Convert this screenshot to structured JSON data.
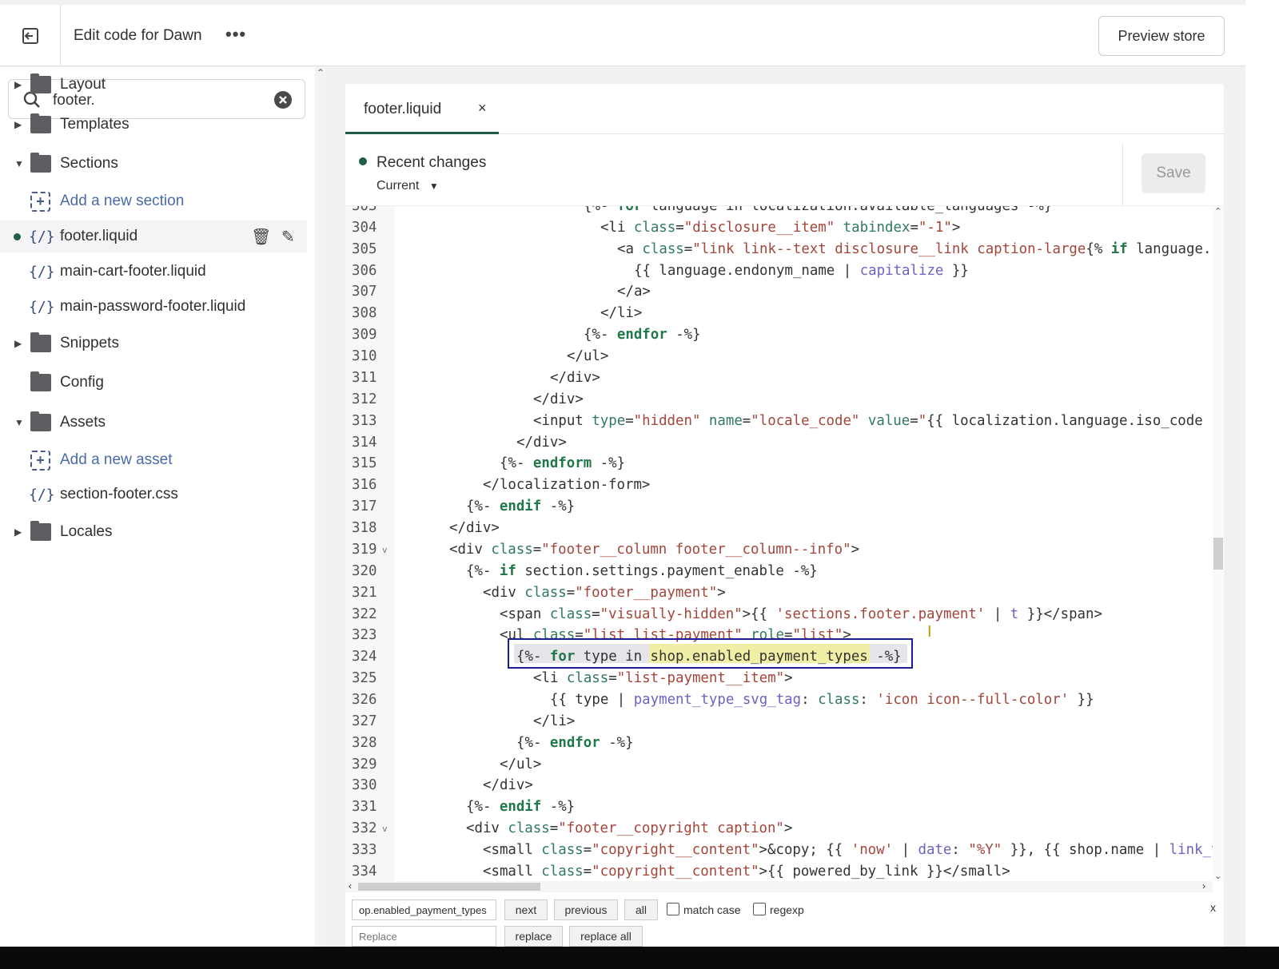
{
  "header": {
    "title": "Edit code for Dawn",
    "more_label": "•••",
    "preview_label": "Preview store",
    "back_icon": "exit-icon"
  },
  "sidebar": {
    "search_value": "footer.",
    "items": [
      {
        "type": "folder",
        "label": "Layout",
        "expanded": false
      },
      {
        "type": "folder",
        "label": "Templates",
        "expanded": false
      },
      {
        "type": "folder",
        "label": "Sections",
        "expanded": true
      },
      {
        "type": "add",
        "label": "Add a new section"
      },
      {
        "type": "file",
        "label": "footer.liquid",
        "active": true,
        "modified": true
      },
      {
        "type": "file",
        "label": "main-cart-footer.liquid"
      },
      {
        "type": "file",
        "label": "main-password-footer.liquid"
      },
      {
        "type": "folder",
        "label": "Snippets",
        "expanded": false
      },
      {
        "type": "folder",
        "label": "Config",
        "noarrow": true
      },
      {
        "type": "folder",
        "label": "Assets",
        "expanded": true
      },
      {
        "type": "add",
        "label": "Add a new asset"
      },
      {
        "type": "file",
        "label": "section-footer.css"
      },
      {
        "type": "folder",
        "label": "Locales",
        "expanded": false
      }
    ]
  },
  "editor": {
    "tab": {
      "label": "footer.liquid",
      "close": "×"
    },
    "recent_changes": "Recent changes",
    "version": "Current",
    "save_label": "Save",
    "lines": [
      {
        "n": "303",
        "i": 22,
        "tk": [
          [
            "p",
            "{%- "
          ],
          [
            "k",
            "for"
          ],
          [
            "p",
            " language in localization.available_languages -%}"
          ]
        ]
      },
      {
        "n": "304",
        "i": 24,
        "tk": [
          [
            "t",
            "<li "
          ],
          [
            "a",
            "class"
          ],
          [
            "t",
            "="
          ],
          [
            "s",
            "\"disclosure__item\""
          ],
          [
            "a",
            " tabindex"
          ],
          [
            "t",
            "="
          ],
          [
            "s",
            "\"-1\""
          ],
          [
            "t",
            ">"
          ]
        ]
      },
      {
        "n": "305",
        "i": 26,
        "tk": [
          [
            "t",
            "<a "
          ],
          [
            "a",
            "class"
          ],
          [
            "t",
            "="
          ],
          [
            "s",
            "\"link link--text disclosure__link caption-large"
          ],
          [
            "p",
            "{% "
          ],
          [
            "k",
            "if"
          ],
          [
            "p",
            " language.iso_code == localization.language.iso_code %}"
          ]
        ]
      },
      {
        "n": "306",
        "i": 28,
        "tk": [
          [
            "p",
            "{{ language.endonym_name | "
          ],
          [
            "f",
            "capitalize"
          ],
          [
            "p",
            " }}"
          ]
        ]
      },
      {
        "n": "307",
        "i": 26,
        "tk": [
          [
            "t",
            "</a>"
          ]
        ]
      },
      {
        "n": "308",
        "i": 24,
        "tk": [
          [
            "t",
            "</li>"
          ]
        ]
      },
      {
        "n": "309",
        "i": 22,
        "tk": [
          [
            "p",
            "{%- "
          ],
          [
            "k",
            "endfor"
          ],
          [
            "p",
            " -%}"
          ]
        ]
      },
      {
        "n": "310",
        "i": 20,
        "tk": [
          [
            "t",
            "</ul>"
          ]
        ]
      },
      {
        "n": "311",
        "i": 18,
        "tk": [
          [
            "t",
            "</div>"
          ]
        ]
      },
      {
        "n": "312",
        "i": 16,
        "tk": [
          [
            "t",
            "</div>"
          ]
        ]
      },
      {
        "n": "313",
        "i": 16,
        "tk": [
          [
            "t",
            "<input "
          ],
          [
            "a",
            "type"
          ],
          [
            "t",
            "="
          ],
          [
            "s",
            "\"hidden\""
          ],
          [
            "a",
            " name"
          ],
          [
            "t",
            "="
          ],
          [
            "s",
            "\"locale_code\""
          ],
          [
            "a",
            " value"
          ],
          [
            "t",
            "="
          ],
          [
            "s",
            "\""
          ],
          [
            "p",
            "{{ localization.language.iso_code }}"
          ],
          [
            "s",
            "\""
          ],
          [
            "t",
            ">"
          ]
        ]
      },
      {
        "n": "314",
        "i": 14,
        "tk": [
          [
            "t",
            "</div>"
          ]
        ]
      },
      {
        "n": "315",
        "i": 12,
        "tk": [
          [
            "p",
            "{%- "
          ],
          [
            "k",
            "endform"
          ],
          [
            "p",
            " -%}"
          ]
        ]
      },
      {
        "n": "316",
        "i": 10,
        "tk": [
          [
            "t",
            "</localization-form>"
          ]
        ]
      },
      {
        "n": "317",
        "i": 8,
        "tk": [
          [
            "p",
            "{%- "
          ],
          [
            "k",
            "endif"
          ],
          [
            "p",
            " -%}"
          ]
        ]
      },
      {
        "n": "318",
        "i": 6,
        "tk": [
          [
            "t",
            "</div>"
          ]
        ]
      },
      {
        "n": "319",
        "i": 6,
        "fold": true,
        "tk": [
          [
            "t",
            "<div "
          ],
          [
            "a",
            "class"
          ],
          [
            "t",
            "="
          ],
          [
            "s",
            "\"footer__column footer__column--info\""
          ],
          [
            "t",
            ">"
          ]
        ]
      },
      {
        "n": "320",
        "i": 8,
        "tk": [
          [
            "p",
            "{%- "
          ],
          [
            "k",
            "if"
          ],
          [
            "p",
            " section.settings.payment_enable -%}"
          ]
        ]
      },
      {
        "n": "321",
        "i": 10,
        "tk": [
          [
            "t",
            "<div "
          ],
          [
            "a",
            "class"
          ],
          [
            "t",
            "="
          ],
          [
            "s",
            "\"footer__payment\""
          ],
          [
            "t",
            ">"
          ]
        ]
      },
      {
        "n": "322",
        "i": 12,
        "tk": [
          [
            "t",
            "<span "
          ],
          [
            "a",
            "class"
          ],
          [
            "t",
            "="
          ],
          [
            "s",
            "\"visually-hidden\""
          ],
          [
            "t",
            ">"
          ],
          [
            "p",
            "{{ "
          ],
          [
            "s",
            "'sections.footer.payment'"
          ],
          [
            "p",
            " | "
          ],
          [
            "f",
            "t"
          ],
          [
            "p",
            " }}"
          ],
          [
            "t",
            "</span>"
          ]
        ]
      },
      {
        "n": "323",
        "i": 12,
        "tk": [
          [
            "t",
            "<ul "
          ],
          [
            "a",
            "class"
          ],
          [
            "t",
            "="
          ],
          [
            "s",
            "\"list list-payment\""
          ],
          [
            "a",
            " role"
          ],
          [
            "t",
            "="
          ],
          [
            "s",
            "\"list\""
          ],
          [
            "t",
            ">"
          ]
        ]
      },
      {
        "n": "324",
        "i": 14,
        "tk": [
          [
            "p",
            "{%- "
          ],
          [
            "k",
            "for"
          ],
          [
            "p",
            " type in shop.enabled_payment_types -%}"
          ]
        ]
      },
      {
        "n": "325",
        "i": 16,
        "tk": [
          [
            "t",
            "<li "
          ],
          [
            "a",
            "class"
          ],
          [
            "t",
            "="
          ],
          [
            "s",
            "\"list-payment__item\""
          ],
          [
            "t",
            ">"
          ]
        ]
      },
      {
        "n": "326",
        "i": 18,
        "tk": [
          [
            "p",
            "{{ type | "
          ],
          [
            "f",
            "payment_type_svg_tag"
          ],
          [
            "p",
            ": "
          ],
          [
            "a",
            "class"
          ],
          [
            "p",
            ": "
          ],
          [
            "s",
            "'icon icon--full-color'"
          ],
          [
            "p",
            " }}"
          ]
        ]
      },
      {
        "n": "327",
        "i": 16,
        "tk": [
          [
            "t",
            "</li>"
          ]
        ]
      },
      {
        "n": "328",
        "i": 14,
        "tk": [
          [
            "p",
            "{%- "
          ],
          [
            "k",
            "endfor"
          ],
          [
            "p",
            " -%}"
          ]
        ]
      },
      {
        "n": "329",
        "i": 12,
        "tk": [
          [
            "t",
            "</ul>"
          ]
        ]
      },
      {
        "n": "330",
        "i": 10,
        "tk": [
          [
            "t",
            "</div>"
          ]
        ]
      },
      {
        "n": "331",
        "i": 8,
        "tk": [
          [
            "p",
            "{%- "
          ],
          [
            "k",
            "endif"
          ],
          [
            "p",
            " -%}"
          ]
        ]
      },
      {
        "n": "332",
        "i": 8,
        "fold": true,
        "tk": [
          [
            "t",
            "<div "
          ],
          [
            "a",
            "class"
          ],
          [
            "t",
            "="
          ],
          [
            "s",
            "\"footer__copyright caption\""
          ],
          [
            "t",
            ">"
          ]
        ]
      },
      {
        "n": "333",
        "i": 10,
        "tk": [
          [
            "t",
            "<small "
          ],
          [
            "a",
            "class"
          ],
          [
            "t",
            "="
          ],
          [
            "s",
            "\"copyright__content\""
          ],
          [
            "t",
            ">&copy; "
          ],
          [
            "p",
            "{{ "
          ],
          [
            "s",
            "'now'"
          ],
          [
            "p",
            " | "
          ],
          [
            "f",
            "date"
          ],
          [
            "p",
            ": "
          ],
          [
            "s",
            "\"%Y\""
          ],
          [
            "p",
            " }}, {{ shop.name | "
          ],
          [
            "f",
            "link_to: routes.root_url"
          ],
          [
            "p",
            " }}"
          ]
        ]
      },
      {
        "n": "334",
        "i": 10,
        "tk": [
          [
            "t",
            "<small "
          ],
          [
            "a",
            "class"
          ],
          [
            "t",
            "="
          ],
          [
            "s",
            "\"copyright__content\""
          ],
          [
            "t",
            ">"
          ],
          [
            "p",
            "{{ powered_by_link }}"
          ],
          [
            "t",
            "</small>"
          ]
        ]
      }
    ]
  },
  "find": {
    "query": "op.enabled_payment_types",
    "next": "next",
    "previous": "previous",
    "all": "all",
    "match_case": "match case",
    "regexp": "regexp",
    "replace_placeholder": "Replace",
    "replace": "replace",
    "replace_all": "replace all",
    "close": "x"
  },
  "colors": {
    "accent": "#205c48",
    "highlight_border": "#1c1c96",
    "match": "#f0efa6"
  }
}
